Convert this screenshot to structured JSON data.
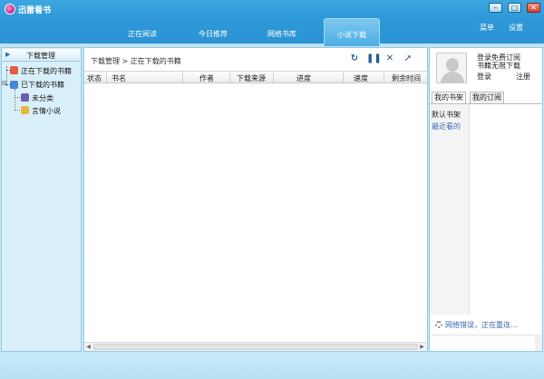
{
  "app": {
    "title": "迅雷看书",
    "menu": {
      "menu_label": "菜单",
      "settings_label": "设置"
    },
    "window_buttons": [
      "minimize",
      "maximize",
      "close"
    ]
  },
  "tabs": [
    {
      "label": "正在阅读",
      "active": false
    },
    {
      "label": "今日推荐",
      "active": false
    },
    {
      "label": "网络书库",
      "active": false
    },
    {
      "label": "小说下载",
      "active": true
    }
  ],
  "tree": {
    "header": "下载管理",
    "items": [
      {
        "label": "正在下载的书籍",
        "icon": "download-folder-icon"
      },
      {
        "label": "已下载的书籍",
        "icon": "downloaded-books-icon"
      },
      {
        "label": "未分类",
        "icon": "book-icon"
      },
      {
        "label": "言情小说",
        "icon": "book-icon"
      }
    ]
  },
  "center": {
    "breadcrumb": "下载管理 > 正在下载的书籍",
    "toolbar": [
      "refresh-icon",
      "pause-icon",
      "delete-icon",
      "open-icon"
    ],
    "columns": [
      "状态",
      "书名",
      "作者",
      "下载来源",
      "进度",
      "速度",
      "剩余时间"
    ]
  },
  "right": {
    "promo_line1": "登录免费订阅",
    "promo_line2": "书籍无限下载",
    "login_label": "登录",
    "register_label": "注册",
    "tabs": [
      {
        "label": "我的书架",
        "active": true
      },
      {
        "label": "我的订阅",
        "active": false
      }
    ],
    "shelf_items": [
      "默认书架",
      "最近看的"
    ],
    "status_text": "网络错误，正在重连…"
  },
  "colors": {
    "accent": "#2b93d4",
    "panel_bg": "#d9f0fb",
    "link_blue": "#3a67b4"
  }
}
